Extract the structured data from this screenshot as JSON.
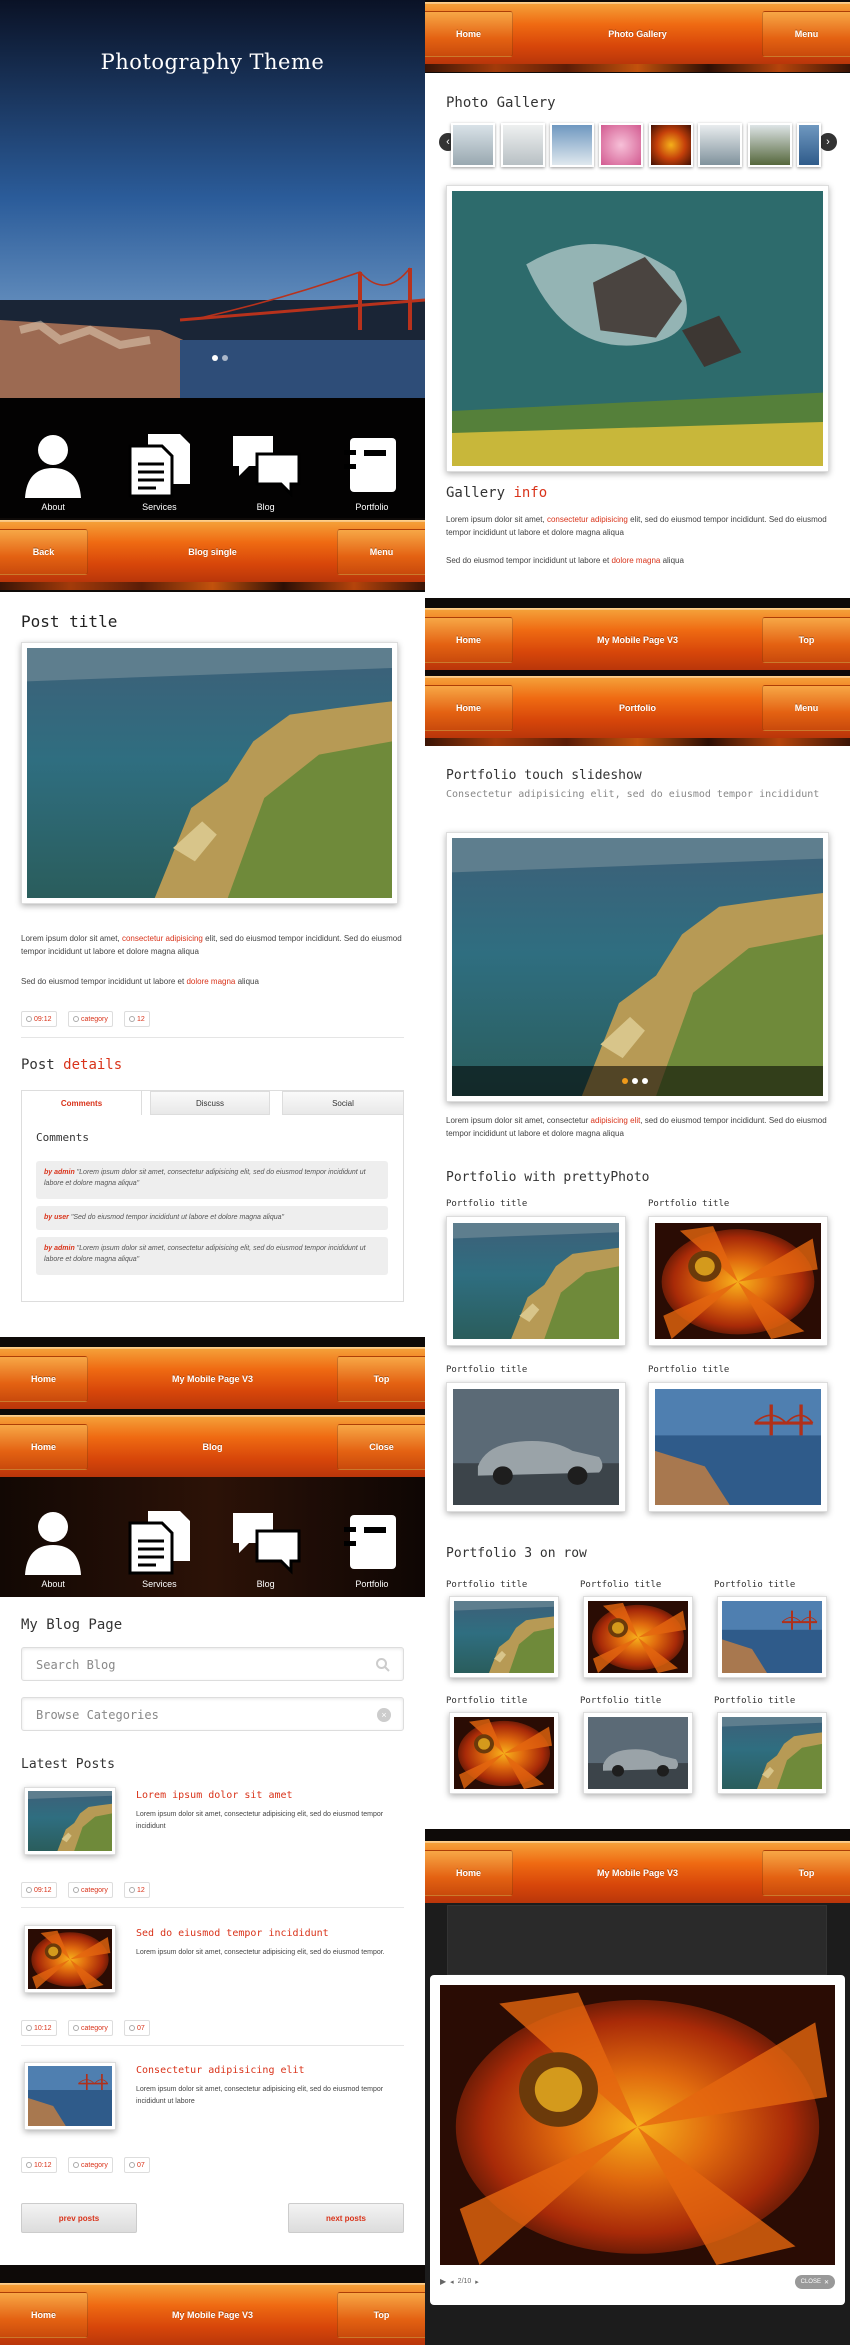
{
  "left": {
    "hero": {
      "title": "Photography Theme"
    },
    "icons": [
      {
        "label": "About",
        "icon": "person-icon"
      },
      {
        "label": "Services",
        "icon": "documents-icon"
      },
      {
        "label": "Blog",
        "icon": "speech-bubbles-icon"
      },
      {
        "label": "Portfolio",
        "icon": "notebook-icon"
      }
    ],
    "bar1": {
      "left": "Back",
      "title": "Blog single",
      "right": "Menu"
    },
    "post": {
      "title": "Post title",
      "p1_a": "Lorem ipsum dolor sit amet, ",
      "p1_link": "consectetur adipisicing",
      "p1_b": " elit, sed do eiusmod tempor incididunt. Sed do eiusmod tempor incididunt ut labore et dolore magna aliqua",
      "p2_a": "Sed do eiusmod tempor incididunt ut labore et ",
      "p2_link": "dolore magna",
      "p2_b": " aliqua",
      "tags": [
        "09:12",
        "category",
        "12"
      ],
      "details_a": "Post ",
      "details_b": "details",
      "tabs": [
        "Comments",
        "Discuss",
        "Social"
      ],
      "comments_title": "Comments",
      "comments": [
        {
          "user": "by admin",
          "text": " \"Lorem ipsum dolor sit amet, consectetur adipisicing elit, sed do eiusmod tempor incididunt ut labore et dolore magna aliqua\""
        },
        {
          "user": "by user",
          "text": " \"Sed do eiusmod tempor incididunt ut labore et dolore magna aliqua\""
        },
        {
          "user": "by admin",
          "text": " \"Lorem ipsum dolor sit amet, consectetur adipisicing elit, sed do eiusmod tempor incididunt ut labore et dolore magna aliqua\""
        }
      ]
    },
    "bar2": {
      "left": "Home",
      "title": "My Mobile Page V3",
      "right": "Top"
    },
    "bar3": {
      "left": "Home",
      "title": "Blog",
      "right": "Close"
    },
    "blog": {
      "title": "My Blog Page",
      "search_placeholder": "Search Blog",
      "categories_placeholder": "Browse Categories",
      "latest": "Latest Posts",
      "posts": [
        {
          "title": "Lorem ipsum dolor sit amet",
          "text": "Lorem ipsum dolor sit amet, consectetur adipisicing elit, sed do eiusmod tempor incididunt",
          "tags": [
            "09:12",
            "category",
            "12"
          ]
        },
        {
          "title": "Sed do eiusmod tempor incididunt",
          "text": "Lorem ipsum dolor sit amet, consectetur adipisicing elit, sed do eiusmod tempor.",
          "tags": [
            "10:12",
            "category",
            "07"
          ]
        },
        {
          "title": "Consectetur adipisicing elit",
          "text": "Lorem ipsum dolor sit amet, consectetur adipisicing elit, sed do eiusmod tempor incididunt ut labore",
          "tags": [
            "10:12",
            "category",
            "07"
          ]
        }
      ],
      "prev": "prev posts",
      "next": "next posts"
    },
    "bar4": {
      "left": "Home",
      "title": "My Mobile Page V3",
      "right": "Top"
    }
  },
  "right": {
    "bar1": {
      "left": "Home",
      "title": "Photo Gallery",
      "right": "Menu"
    },
    "gallery": {
      "title": "Photo Gallery",
      "info_a": "Gallery ",
      "info_b": "info",
      "p1_a": "Lorem ipsum dolor sit amet, ",
      "p1_link": "consectetur adipisicing",
      "p1_b": " elit, sed do eiusmod tempor incididunt. Sed do eiusmod tempor incididunt ut labore et dolore magna aliqua",
      "p2_a": "Sed do eiusmod tempor incididunt ut labore et ",
      "p2_link": "dolore magna",
      "p2_b": " aliqua"
    },
    "bar2": {
      "left": "Home",
      "title": "My Mobile Page V3",
      "right": "Top"
    },
    "bar3": {
      "left": "Home",
      "title": "Portfolio",
      "right": "Menu"
    },
    "portfolio": {
      "title": "Portfolio touch slideshow",
      "subtitle": "Consectetur adipisicing elit, sed do eiusmod tempor incididunt",
      "p_a": "Lorem ipsum dolor sit amet, consectetur ",
      "p_link": "adipisicing elit",
      "p_b": ", sed do eiusmod tempor incididunt. Sed do eiusmod tempor incididunt ut labore et dolore magna aliqua",
      "pretty": "Portfolio with prettyPhoto",
      "cap": "Portfolio title",
      "row3": "Portfolio 3 on row"
    },
    "bar4": {
      "left": "Home",
      "title": "My Mobile Page V3",
      "right": "Top"
    },
    "lightbox": {
      "counter": "2/10",
      "close": "CLOSE"
    }
  },
  "colors": {
    "accent": "#d9331a",
    "bar": "#e55b10"
  }
}
